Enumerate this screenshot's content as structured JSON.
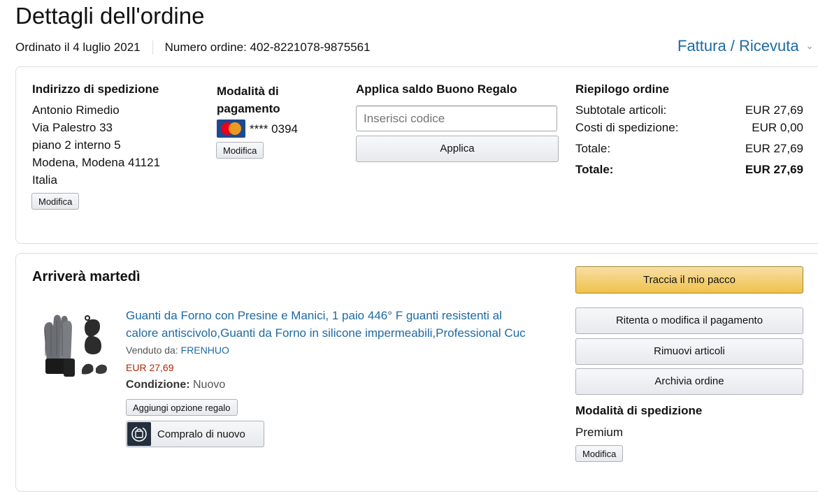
{
  "page": {
    "title": "Dettagli dell'ordine",
    "order_date": "Ordinato il 4 luglio 2021",
    "order_number": "Numero ordine: 402-8221078-9875561",
    "invoice_link": "Fattura / Ricevuta"
  },
  "shipping_address": {
    "heading": "Indirizzo di spedizione",
    "lines": [
      "Antonio Rimedio",
      "Via Palestro 33",
      "piano 2 interno 5",
      "Modena, Modena 41121",
      "Italia"
    ],
    "edit_label": "Modifica"
  },
  "payment": {
    "heading_line1": "Modalità di",
    "heading_line2": "pagamento",
    "card_brand": "MasterCard",
    "card_number": "**** 0394",
    "edit_label": "Modifica"
  },
  "gift_card": {
    "heading": "Applica saldo Buono Regalo",
    "placeholder": "Inserisci codice",
    "apply_label": "Applica"
  },
  "summary": {
    "heading": "Riepilogo ordine",
    "rows": [
      {
        "label": "Subtotale articoli:",
        "value": "EUR 27,69"
      },
      {
        "label": "Costi di spedizione:",
        "value": "EUR 0,00"
      },
      {
        "label": "Totale:",
        "value": "EUR 27,69"
      }
    ],
    "grand_total_label": "Totale:",
    "grand_total_value": "EUR 27,69"
  },
  "shipment": {
    "heading": "Arriverà martedì",
    "product_title_line1": "Guanti da Forno con Presine e Manici, 1 paio 446° F guanti resistenti al",
    "product_title_line2": "calore antiscivolo,Guanti da Forno in silicone impermeabili,Professional Cuc",
    "sold_by_label": "Venduto da:",
    "seller": "FRENHUO",
    "price": "EUR 27,69",
    "condition_label": "Condizione:",
    "condition_value": "Nuovo",
    "gift_option_label": "Aggiungi opzione regalo",
    "buy_again_label": "Compralo di nuovo"
  },
  "actions": {
    "track": "Traccia il mio pacco",
    "retry_payment": "Ritenta o modifica il pagamento",
    "remove_items": "Rimuovi articoli",
    "archive": "Archivia ordine",
    "shipping_method_heading": "Modalità di spedizione",
    "shipping_method_value": "Premium",
    "edit_label": "Modifica"
  },
  "colors": {
    "link": "#1c6aa4",
    "price": "#b12704",
    "primary_button": "#f0c14b"
  }
}
